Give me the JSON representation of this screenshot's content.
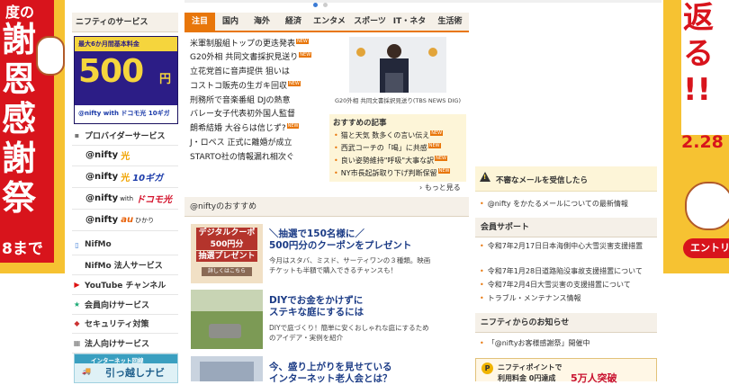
{
  "left_ad": {
    "chars": [
      "度の",
      "謝",
      "恩",
      "感",
      "謝",
      "祭"
    ],
    "until": "8まで"
  },
  "right_ad": {
    "chars": [
      "返",
      "る",
      "!!"
    ],
    "date": "2.28",
    "button": "エントリ"
  },
  "carousel": {
    "dots": 2
  },
  "left_column": {
    "header": "ニフティのサービス",
    "banner": {
      "top_line": "最大6か月間基本料金",
      "price": "500",
      "unit": "円",
      "note": "〜",
      "brand": "@nifty with ドコモ光 10ギガ"
    },
    "provider_label": "プロバイダーサービス",
    "logos": [
      {
        "name": "@nifty",
        "suffix": "光",
        "extra": ""
      },
      {
        "name": "@nifty",
        "suffix": "光",
        "extra": "10ギガ"
      },
      {
        "name": "@nifty",
        "suffix": "with",
        "extra": "ドコモ光"
      },
      {
        "name": "@nifty",
        "suffix": "au",
        "extra": "ひかり"
      }
    ],
    "menu": [
      {
        "label": "NifMo",
        "icon": "phone-icon"
      },
      {
        "label": "NifMo 法人サービス",
        "icon": ""
      },
      {
        "label": "YouTube チャンネル",
        "icon": "youtube-icon"
      },
      {
        "label": "会員向けサービス",
        "icon": "star-icon"
      },
      {
        "label": "セキュリティ対策",
        "icon": "shield-icon"
      },
      {
        "label": "法人向けサービス",
        "icon": "building-icon"
      }
    ],
    "bottom_banner": {
      "top": "インターネット回線",
      "main": "引っ越しナビ"
    }
  },
  "tabs": [
    "注目",
    "国内",
    "海外",
    "経済",
    "エンタメ",
    "スポーツ",
    "IT・ネタ",
    "生活術"
  ],
  "news": [
    {
      "text": "米軍制服組トップの更迭発表",
      "new": true
    },
    {
      "text": "G20外相 共同文書採択見送り",
      "new": true
    },
    {
      "text": "立花党首に音声提供 狙いは",
      "new": false
    },
    {
      "text": "コストコ販売の生ガキ回収",
      "new": true
    },
    {
      "text": "刑務所で音楽番組 DJの熱意",
      "new": false
    },
    {
      "text": "バレー女子代表初外国人監督",
      "new": false
    },
    {
      "text": "朗希結婚 大谷らは信じず?",
      "new": true
    },
    {
      "text": "J・ロペス 正式に離婚が成立",
      "new": false
    },
    {
      "text": "STARTO社の情報漏れ相次ぐ",
      "new": false
    }
  ],
  "new_label": "NEW",
  "photo_caption": "G20外相 共同文書採択見送り(TBS NEWS DIG)",
  "recommend": {
    "title": "おすすめの記事",
    "items": [
      {
        "text": "猫と天気 数多くの言い伝え",
        "new": true
      },
      {
        "text": "西武コーチの「喝」に共感",
        "new": true
      },
      {
        "text": "良い姿勢維持\"呼吸\"大事な訳",
        "new": true
      },
      {
        "text": "NY市長起訴取り下げ判断保留",
        "new": true
      }
    ],
    "more": "› もっと見る"
  },
  "featured": {
    "header": "@niftyのおすすめ",
    "cards": [
      {
        "thumb_lines": [
          "デジタルクーポン",
          "500円分",
          "抽選プレゼント",
          "詳しくはこちら"
        ],
        "title": [
          "＼抽選で150名様に／",
          "500円分のクーポンをプレゼント"
        ],
        "desc": [
          "今月はスタバ、ミスド、サーティワンの３種類。映画",
          "チケットも半額で購入できるチャンスも！"
        ]
      },
      {
        "thumb_lines": [],
        "title": [
          "DIYでお金をかけずに",
          "ステキな庭にするには"
        ],
        "desc": [
          "DIYで庭づくり！簡単に安くおしゃれな庭にするため",
          "のアイデア・実例を紹介"
        ]
      },
      {
        "thumb_lines": [],
        "title": [
          "今、盛り上がりを見せている",
          "インターネット老人会とは？"
        ],
        "desc": []
      }
    ]
  },
  "right_column": {
    "warning": "不審なメールを受信したら",
    "warning_link": "@nifty をかたるメールについての最新情報",
    "support_header": "会員サポート",
    "support_links": [
      "令和7年2月17日日本海側中心大雪災害支援措置",
      "令和7年1月28日道路陥没事故支援措置について",
      "令和7年2月4日大雪災害の支援措置について",
      "トラブル・メンテナンス情報"
    ],
    "info_header": "ニフティからのお知らせ",
    "info_links": [
      "「@niftyお客様感謝祭」開催中"
    ],
    "points": {
      "title": "ニフティポイントで",
      "sub": "利用料金 0円達成",
      "badge": "5万人突破"
    }
  }
}
